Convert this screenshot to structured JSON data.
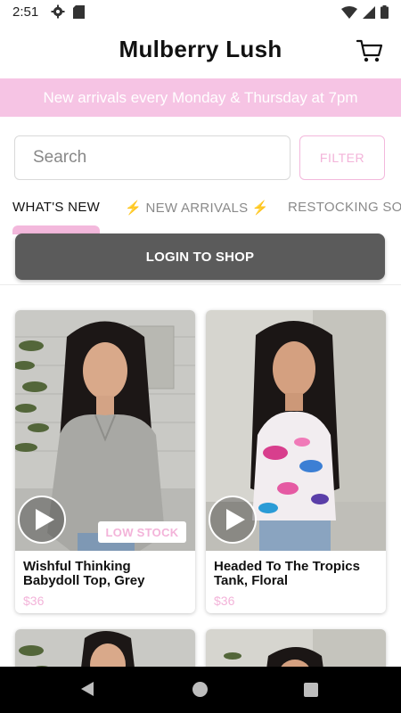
{
  "status_bar": {
    "time": "2:51"
  },
  "header": {
    "title": "Mulberry Lush"
  },
  "banner": {
    "text": "New arrivals every Monday & Thursday at 7pm"
  },
  "search": {
    "placeholder": "Search",
    "filter_label": "FILTER"
  },
  "tabs": [
    {
      "label": "WHAT'S NEW"
    },
    {
      "label": "⚡ NEW ARRIVALS ⚡"
    },
    {
      "label": "RESTOCKING SOO"
    }
  ],
  "login": {
    "label": "LOGIN TO SHOP"
  },
  "products": [
    {
      "title": "Wishful Thinking Babydoll Top, Grey",
      "price": "$36",
      "badge": "LOW STOCK"
    },
    {
      "title": "Headed To The Tropics Tank, Floral",
      "price": "$36"
    }
  ],
  "colors": {
    "accent_pink": "#f3b3d9",
    "banner_pink": "#f6c4e4",
    "login_gray": "#5b5b5b"
  },
  "icons": [
    "settings-icon",
    "sd-card-icon",
    "wifi-icon",
    "signal-icon",
    "battery-icon",
    "cart-icon",
    "play-icon",
    "back-icon",
    "home-icon",
    "recents-icon"
  ]
}
